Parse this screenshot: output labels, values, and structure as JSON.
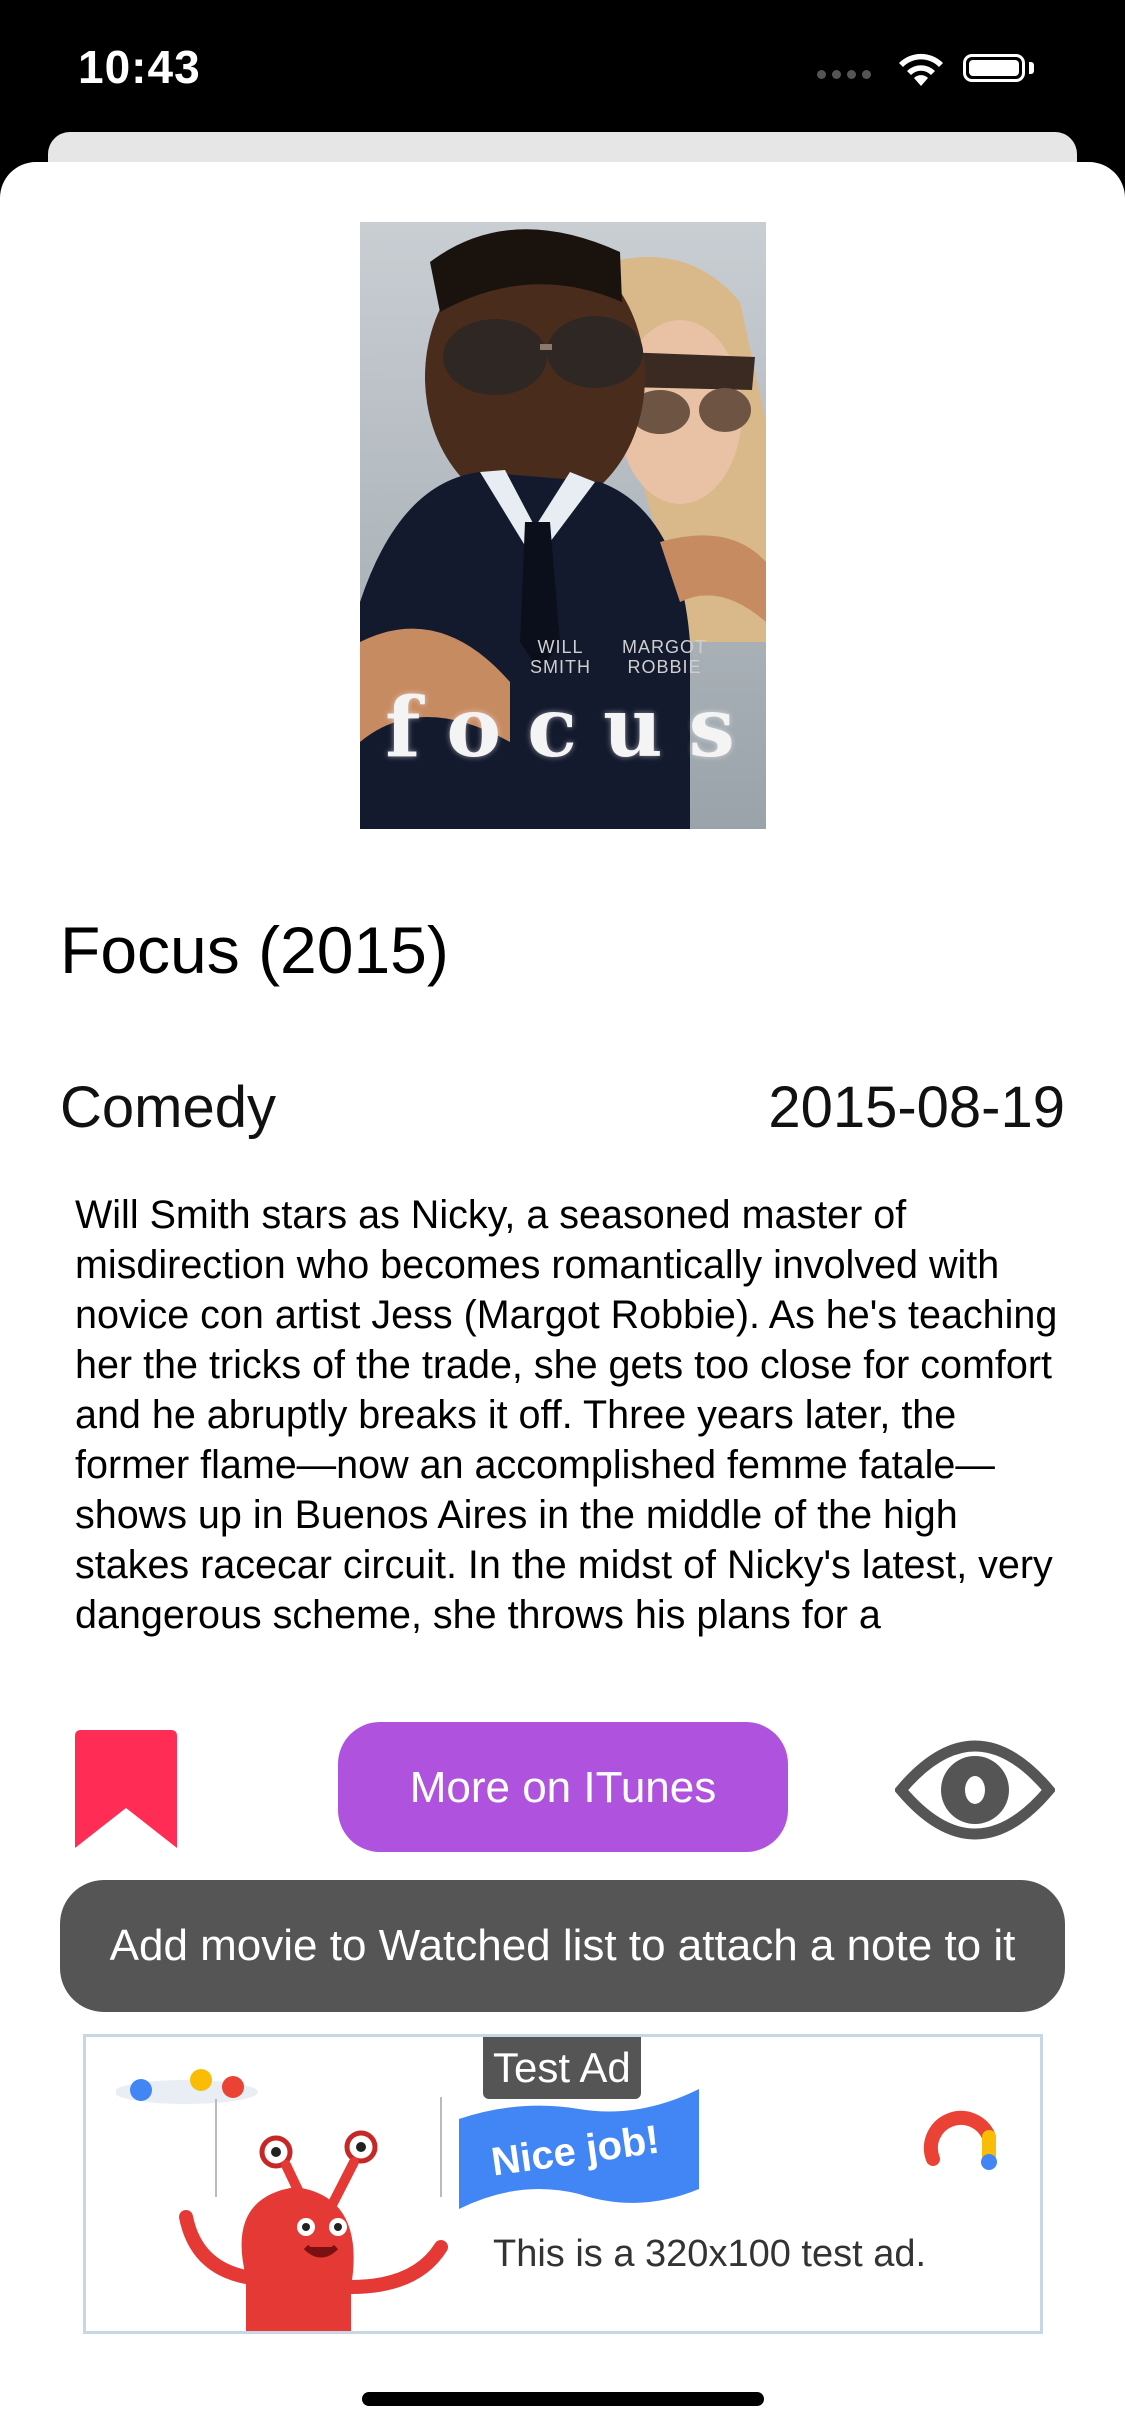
{
  "status_bar": {
    "time": "10:43"
  },
  "movie": {
    "poster_title": "focus",
    "poster_credit_left": "WILL\nSMITH",
    "poster_credit_right": "MARGOT\nROBBIE",
    "title": "Focus (2015)",
    "genre": "Comedy",
    "release_date": "2015-08-19",
    "overview": "Will Smith stars as Nicky, a seasoned master of misdirection who becomes romantically involved with novice con artist Jess (Margot Robbie). As he's teaching her the tricks of the trade, she gets too close for comfort and he abruptly breaks it off. Three years later, the former flame—now an accomplished femme fatale—shows up in Buenos Aires in the middle of the high stakes racecar circuit. In the midst of Nicky's latest, very dangerous scheme, she throws his plans for a"
  },
  "actions": {
    "bookmark_icon": "bookmark-icon",
    "itunes_label": "More on ITunes",
    "watched_icon": "eye-icon"
  },
  "toast": {
    "message": "Add movie to Watched list to attach a note to it"
  },
  "ad": {
    "badge": "Test Ad",
    "flag_text": "Nice job!",
    "text": "This is a 320x100 test ad."
  },
  "colors": {
    "itunes_button": "#af52de",
    "bookmark": "#ff2d55",
    "toast_bg": "#555555",
    "eye_icon": "#555555"
  }
}
